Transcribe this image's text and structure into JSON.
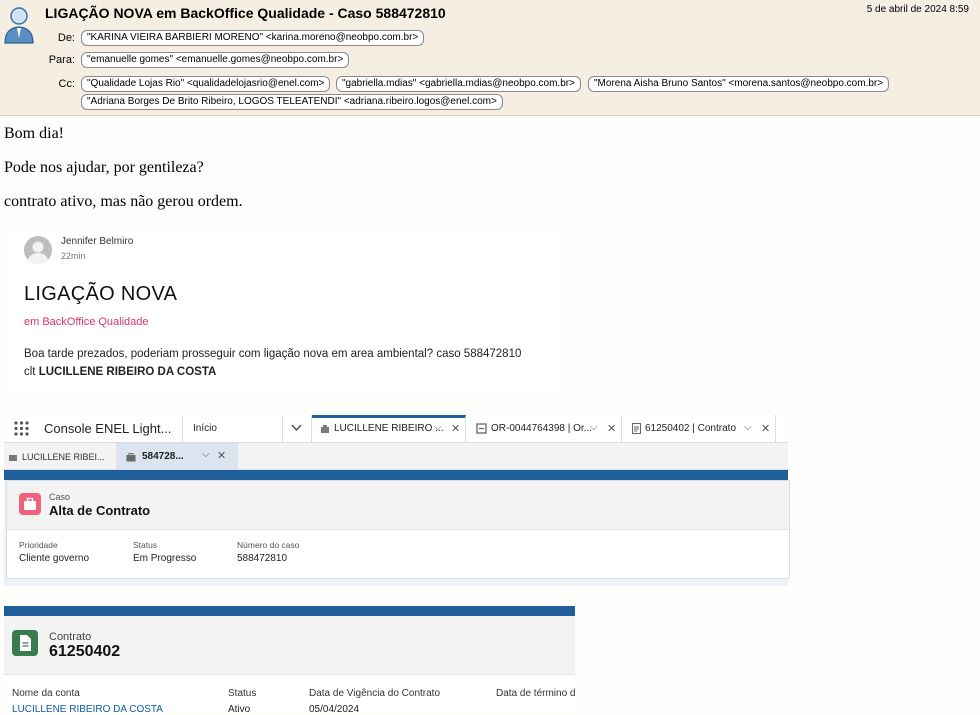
{
  "email": {
    "subject": "LIGAÇÃO NOVA em BackOffice Qualidade - Caso 588472810",
    "date": "5 de abril de 2024 8:59",
    "labels": {
      "from": "De:",
      "to": "Para:",
      "cc": "Cc:"
    },
    "from": "\"KARINA VIEIRA BARBIERI MORENO\" <karina.moreno@neobpo.com.br>",
    "to": "\"emanuelle gomes\" <emanuelle.gomes@neobpo.com.br>",
    "cc": [
      "\"Qualidade Lojas Rio\" <qualidadelojasrio@enel.com>",
      "\"gabriella.mdias\" <gabriella.mdias@neobpo.com.br>",
      "\"Morena Aisha Bruno Santos\" <morena.santos@neobpo.com.br>",
      "\"Adriana Borges De Brito Ribeiro, LOGOS TELEATENDI\" <adriana.ribeiro.logos@enel.com>"
    ],
    "body": [
      "Bom dia!",
      "Pode nos ajudar, por gentileza?",
      "contrato ativo, mas não gerou ordem."
    ]
  },
  "post": {
    "author": "Jennifer Belmiro",
    "time": "22min",
    "title": "LIGAÇÃO NOVA",
    "subtitle": "em BackOffice Qualidade",
    "message_line1": "Boa tarde prezados, poderiam prosseguir com ligação nova em area ambiental? caso 588472810",
    "message_prefix": "clt ",
    "message_name": "LUCILLENE RIBEIRO DA COSTA"
  },
  "console": {
    "app_name": "Console ENEL Light...",
    "nav_select": "Início",
    "tabs": [
      "LUCILLENE RIBEIRO ...",
      "OR-0044764398 | Or...",
      "61250402 | Contrato"
    ],
    "subtabs": [
      "LUCILLENE RIBEI...",
      "584728..."
    ],
    "case": {
      "object_label": "Caso",
      "title": "Alta de Contrato",
      "fields": [
        {
          "label": "Prioridade",
          "value": "Cliente governo"
        },
        {
          "label": "Status",
          "value": "Em Progresso"
        },
        {
          "label": "Número do caso",
          "value": "588472810"
        }
      ]
    }
  },
  "contract": {
    "object_label": "Contrato",
    "number": "61250402",
    "fields": [
      {
        "label": "Nome da conta",
        "value": "LUCILLENE RIBEIRO DA COSTA"
      },
      {
        "label": "Status",
        "value": "Ativo"
      },
      {
        "label": "Data de Vigência do Contrato",
        "value": "05/04/2024"
      },
      {
        "label": "Data de término d",
        "value": ""
      }
    ]
  },
  "colors": {
    "header_bg": "#f4efe2",
    "accent_blue": "#1f5f9c",
    "case_icon": "#f2607e",
    "contract_icon": "#3c7a4f",
    "subtitle_pink": "#d63468"
  }
}
